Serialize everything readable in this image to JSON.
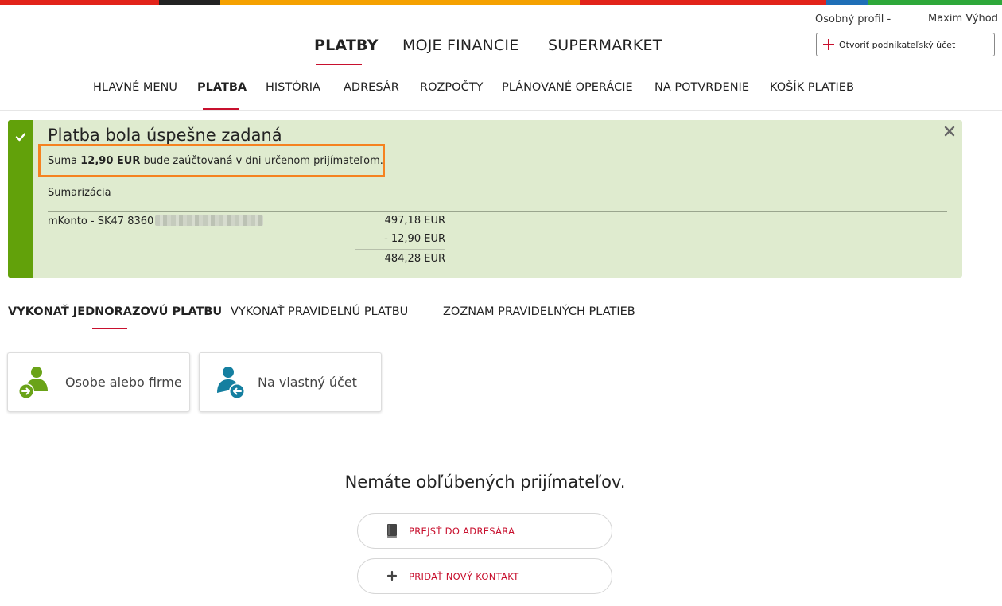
{
  "colors": {
    "brand_red": "#c8102e",
    "success_green": "#62a10a",
    "success_bg": "#dfebcf",
    "highlight_orange": "#f58220",
    "topbar": [
      "#e2231a",
      "#222222",
      "#f5a100",
      "#e2231a",
      "#1f6fb7",
      "#2ea83a"
    ]
  },
  "profile": {
    "label": "Osobný profil  -",
    "user": "Maxim Výhod",
    "open_business": "Otvoriť podnikateľský účet"
  },
  "main_nav": [
    "PLATBY",
    "MOJE FINANCIE",
    "SUPERMARKET"
  ],
  "sub_nav": [
    "HLAVNÉ MENU",
    "PLATBA",
    "HISTÓRIA",
    "ADRESÁR",
    "ROZPOČTY",
    "PLÁNOVANÉ OPERÁCIE",
    "NA POTVRDENIE",
    "KOŠÍK PLATIEB"
  ],
  "alert": {
    "title": "Platba bola úspešne zadaná",
    "msg_prefix": "Suma ",
    "msg_amount": "12,90 EUR",
    "msg_suffix": " bude zaúčtovaná v dni určenom prijímateľom.",
    "summary_label": "Sumarizácia",
    "account": "mKonto - SK47 8360",
    "balance_before": "497,18 EUR",
    "payment": "- 12,90 EUR",
    "balance_after": "484,28 EUR"
  },
  "payment_tabs": [
    "VYKONAŤ JEDNORAZOVÚ PLATBU",
    "VYKONAŤ PRAVIDELNÚ PLATBU",
    "ZOZNAM PRAVIDELNÝCH PLATIEB"
  ],
  "tiles": {
    "person_or_company": "Osobe alebo firme",
    "own_account": "Na vlastný účet"
  },
  "empty_state": {
    "title": "Nemáte obľúbených prijímateľov.",
    "go_to_address_book": "PREJSŤ DO ADRESÁRA",
    "add_contact": "PRIDAŤ NOVÝ KONTAKT"
  }
}
